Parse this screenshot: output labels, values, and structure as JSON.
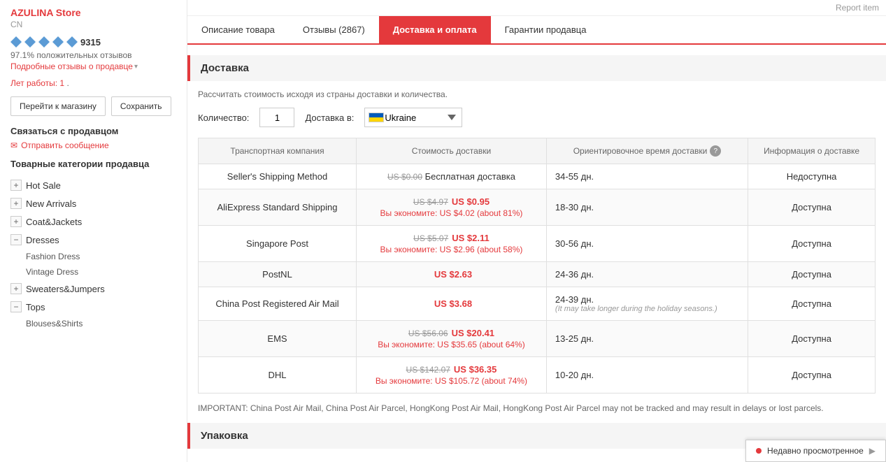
{
  "store": {
    "name": "AZULINA Store",
    "country": "CN",
    "diamonds_count": 5,
    "rating_score": "9315",
    "positive_rating": "97.1%",
    "positive_rating_label": "положительных отзывов",
    "seller_reviews_link": "Подробные отзывы о продавце",
    "years_label": "Лет работы:",
    "years_value": "1",
    "btn_visit": "Перейти к магазину",
    "btn_save": "Сохранить",
    "contact_title": "Связаться с продавцом",
    "send_message": "Отправить сообщение",
    "categories_title": "Товарные категории продавца",
    "categories": [
      {
        "label": "Hot Sale",
        "toggle": "+",
        "expanded": false
      },
      {
        "label": "New Arrivals",
        "toggle": "+",
        "expanded": false
      },
      {
        "label": "Coat&Jackets",
        "toggle": "+",
        "expanded": false
      },
      {
        "label": "Dresses",
        "toggle": "−",
        "expanded": true
      },
      {
        "label": "Sweaters&Jumpers",
        "toggle": "+",
        "expanded": false
      },
      {
        "label": "Tops",
        "toggle": "−",
        "expanded": true
      }
    ],
    "sub_categories_dresses": [
      "Fashion Dress",
      "Vintage Dress"
    ],
    "sub_categories_tops": [
      "Blouses&Shirts"
    ]
  },
  "tabs": [
    {
      "label": "Описание товара",
      "active": false
    },
    {
      "label": "Отзывы (2867)",
      "active": false
    },
    {
      "label": "Доставка и оплата",
      "active": true
    },
    {
      "label": "Гарантии продавца",
      "active": false
    }
  ],
  "report": {
    "link_label": "Report item"
  },
  "shipping": {
    "section_title": "Доставка",
    "calc_text": "Рассчитать стоимость исходя из страны доставки и количества.",
    "qty_label": "Количество:",
    "qty_value": "1",
    "ship_to_label": "Доставка в:",
    "country": "Ukraine",
    "table_headers": [
      "Транспортная компания",
      "Стоимость доставки",
      "Ориентировочное время доставки",
      "Информация о доставке"
    ],
    "rows": [
      {
        "carrier": "Seller's Shipping Method",
        "price_old": "US $0.00",
        "price_new": "",
        "price_free": "Бесплатная доставка",
        "savings": "",
        "time": "34-55 дн.",
        "holiday_note": "",
        "info": "Недоступна"
      },
      {
        "carrier": "AliExpress Standard Shipping",
        "price_old": "US $4.97",
        "price_new": "US $0.95",
        "price_free": "",
        "savings": "Вы экономите: US $4.02 (about 81%)",
        "time": "18-30 дн.",
        "holiday_note": "",
        "info": "Доступна"
      },
      {
        "carrier": "Singapore Post",
        "price_old": "US $5.07",
        "price_new": "US $2.11",
        "price_free": "",
        "savings": "Вы экономите: US $2.96 (about 58%)",
        "time": "30-56 дн.",
        "holiday_note": "",
        "info": "Доступна"
      },
      {
        "carrier": "PostNL",
        "price_old": "",
        "price_new": "US $2.63",
        "price_free": "",
        "savings": "",
        "time": "24-36 дн.",
        "holiday_note": "",
        "info": "Доступна"
      },
      {
        "carrier": "China Post Registered Air Mail",
        "price_old": "",
        "price_new": "US $3.68",
        "price_free": "",
        "savings": "",
        "time": "24-39 дн.",
        "holiday_note": "(It may take longer during the holiday seasons.)",
        "info": "Доступна"
      },
      {
        "carrier": "EMS",
        "price_old": "US $56.06",
        "price_new": "US $20.41",
        "price_free": "",
        "savings": "Вы экономите: US $35.65 (about 64%)",
        "time": "13-25 дн.",
        "holiday_note": "",
        "info": "Доступна"
      },
      {
        "carrier": "DHL",
        "price_old": "US $142.07",
        "price_new": "US $36.35",
        "price_free": "",
        "savings": "Вы экономите: US $105.72 (about 74%)",
        "time": "10-20 дн.",
        "holiday_note": "",
        "info": "Доступна"
      }
    ],
    "important_note": "IMPORTANT: China Post Air Mail, China Post Air Parcel, HongKong Post Air Mail, HongKong Post Air Parcel may not be tracked and may result in delays or lost parcels.",
    "packaging_title": "Упаковка"
  },
  "recently_viewed": {
    "label": "Недавно просмотренное"
  }
}
